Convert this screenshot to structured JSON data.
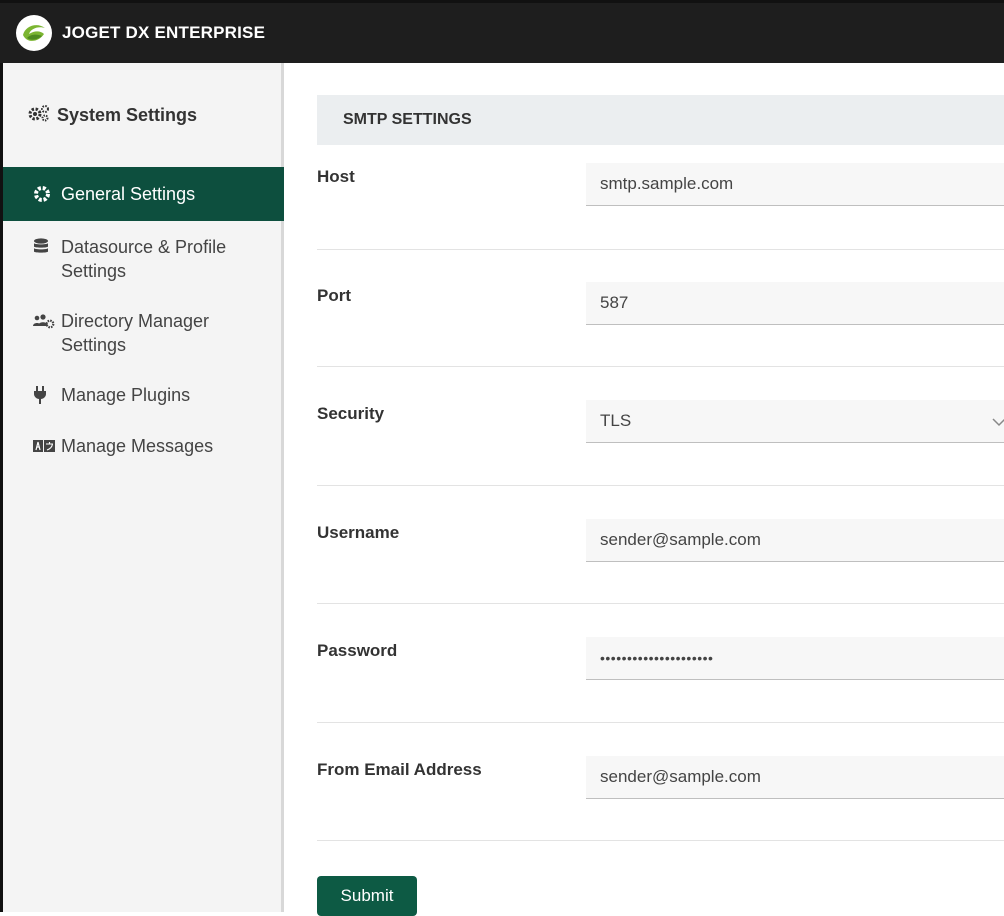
{
  "app": {
    "title": "JOGET DX ENTERPRISE",
    "accent": "#0d4f3e"
  },
  "sidebar": {
    "title": "System Settings",
    "title_icon": "gears-icon",
    "items": [
      {
        "label": "General Settings",
        "icon": "gear-icon",
        "active": true
      },
      {
        "label": "Datasource & Profile Settings",
        "icon": "database-icon",
        "active": false
      },
      {
        "label": "Directory Manager Settings",
        "icon": "users-cog-icon",
        "active": false
      },
      {
        "label": "Manage Plugins",
        "icon": "plug-icon",
        "active": false
      },
      {
        "label": "Manage Messages",
        "icon": "language-icon",
        "active": false
      }
    ]
  },
  "form": {
    "section_title": "SMTP SETTINGS",
    "fields": [
      {
        "label": "Host",
        "value": "smtp.sample.com",
        "type": "text"
      },
      {
        "label": "Port",
        "value": "587",
        "type": "text"
      },
      {
        "label": "Security",
        "value": "TLS",
        "type": "select"
      },
      {
        "label": "Username",
        "value": "sender@sample.com",
        "type": "text"
      },
      {
        "label": "Password",
        "value": "•••••••••••••••••••••",
        "type": "password"
      },
      {
        "label": "From Email Address",
        "value": "sender@sample.com",
        "type": "text"
      }
    ],
    "submit_label": "Submit"
  }
}
